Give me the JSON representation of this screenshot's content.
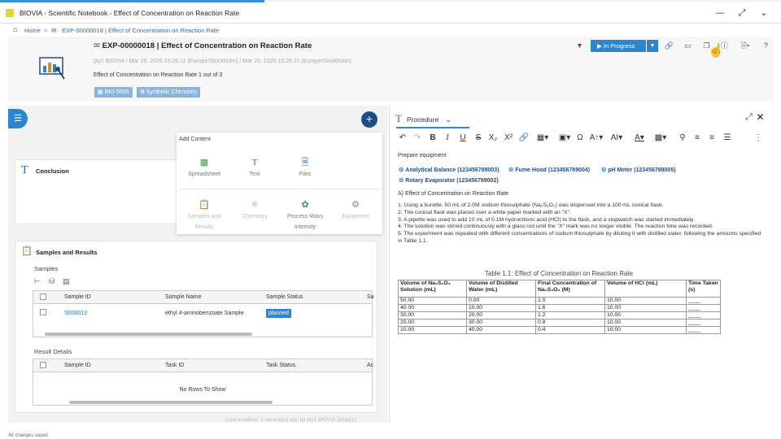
{
  "window": {
    "title": "BIOVIA - Scientific Notebook - Effect of Concentration on Reaction Rate"
  },
  "breadcrumb": {
    "home": "Home",
    "experiment": "EXP-00000018 | Effect of Concentration on Reaction Rate"
  },
  "header": {
    "title": "EXP-00000018 | Effect of Concentration on Reaction Rate",
    "meta": "ply1 BIOVIA / Mar 20, 2025 15:26:11 (Europe/Stockholm) / Mar 20, 2025 15:26:11 (Europe/Stockholm)",
    "description": "Effect of Concentration on Reaction Rate 1 out of 3",
    "tags": [
      "BIO-5555",
      "Synthetic Chemistry"
    ],
    "status": "In Progress"
  },
  "left": {
    "conclusion": "Conclusion",
    "add_content": {
      "title": "Add Content",
      "items": [
        "Spreadsheet",
        "Text",
        "Files",
        "Samples and Results",
        "Chemistry",
        "Process Mass Intensity",
        "Equipment"
      ]
    },
    "samples_results": "Samples and Results",
    "samples_label": "Samples",
    "samples_columns": [
      "Sample ID",
      "Sample Name",
      "Sample Status",
      "Sa"
    ],
    "sample_row": {
      "id": "S000013",
      "name": "ethyl 4-aminobenzoate Sample",
      "status": "planned"
    },
    "result_details": "Result Details",
    "result_columns": [
      "Sample ID",
      "Task ID",
      "Task Status",
      "Ac"
    ],
    "no_rows": "No Rows To Show",
    "last_modified": "Last modified: 5 second(s) ago by ply1 BIOVIA (biopy1)"
  },
  "right": {
    "tab": "Procedure",
    "prepare": "Prepare equipment",
    "equipment": [
      "Analytical Balance (123456789003)",
      "Fume Hood (123456789004)",
      "pH Meter (123456789005)",
      "Rotary Evaporator (123456789002)"
    ],
    "section": "A) Effect of Concentration on Reaction Rate",
    "steps": [
      "1. Using a burette, 50 mL of 2.0M sodium thiosulphate (Na₂S₂O₃) was dispensed into a 100 mL conical flask.",
      "2. The conical flask was placed over a white paper marked with an \"X\".",
      "3. A pipette was used to add 10 mL of 0.1M hydrochloric acid (HCl) to the flask, and a stopwatch was started immediately.",
      "4. The solution was stirred continuously with a glass rod until the \"X\" mark was no longer visible. The reaction time was recorded.",
      "5. The experiment was repeated with different concentrations of sodium thiosulphate by diluting it with distilled water, following the amounts specified in Table 1.1."
    ],
    "table": {
      "caption": "Table 1.1: Effect of Concentration on Reaction Rate",
      "headers": [
        "Volume of Na₂S₂O₃ Solution (mL)",
        "Volume of Distilled Water (mL)",
        "Final Concentration of Na₂S₂O₃ (M)",
        "Volume of HCl (mL)",
        "Time Taken (s)"
      ],
      "rows": [
        [
          "50.00",
          "0.00",
          "2.0",
          "10.00",
          "____"
        ],
        [
          "40.00",
          "10.00",
          "1.6",
          "10.00",
          "____"
        ],
        [
          "30.00",
          "20.00",
          "1.2",
          "10.00",
          "____"
        ],
        [
          "20.00",
          "30.00",
          "0.8",
          "10.00",
          "____"
        ],
        [
          "10.00",
          "40.00",
          "0.4",
          "10.00",
          "____"
        ]
      ]
    }
  },
  "statusbar": "All changes saved"
}
